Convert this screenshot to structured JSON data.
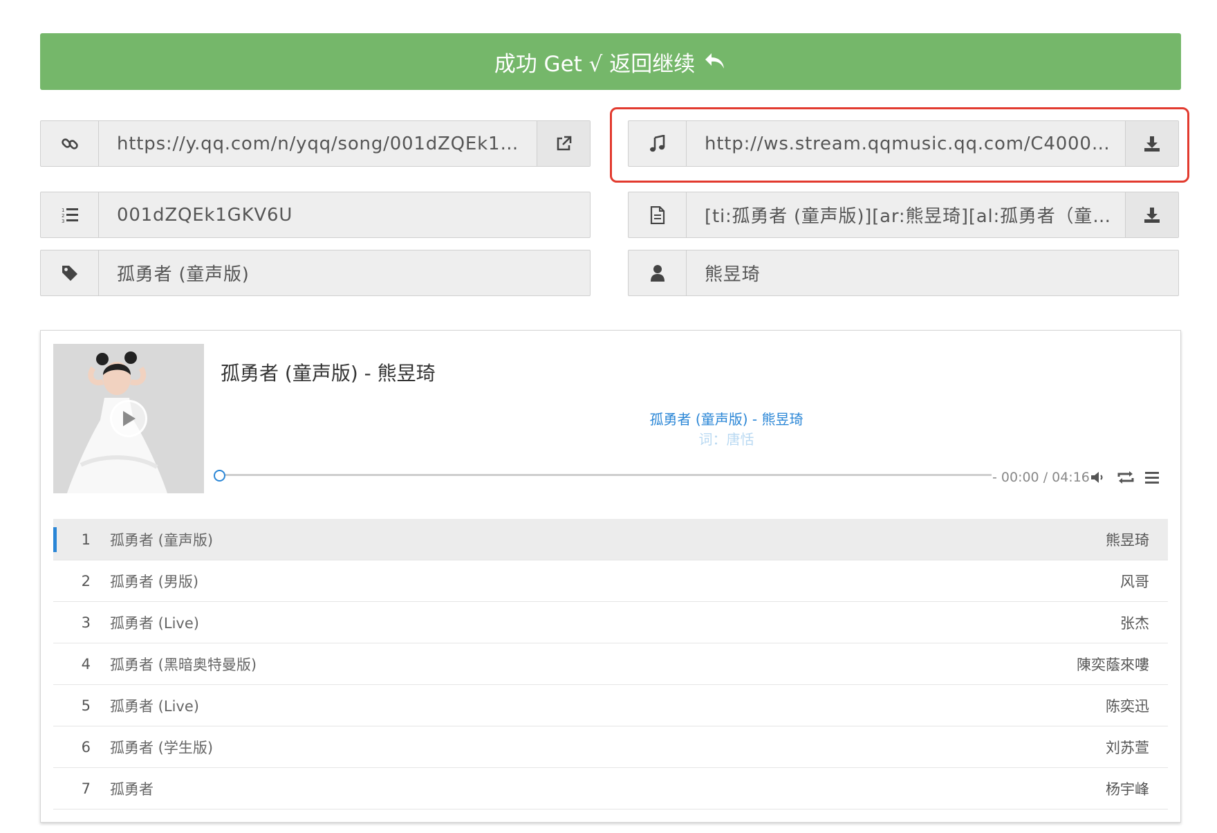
{
  "banner": {
    "text": "成功 Get √ 返回继续"
  },
  "fields": {
    "song_url": "https://y.qq.com/n/yqq/song/001dZQEk1G...",
    "stream_url": "http://ws.stream.qqmusic.qq.com/C400001...",
    "song_mid": "001dZQEk1GKV6U",
    "lyrics": "[ti:孤勇者 (童声版)][ar:熊昱琦][al:孤勇者（童声...",
    "song_name": "孤勇者 (童声版)",
    "artist": "熊昱琦"
  },
  "player": {
    "title": "孤勇者 (童声版) - 熊昱琦",
    "lyric_current": "孤勇者 (童声版) - 熊昱琦",
    "lyric_next": "词：唐恬",
    "time": "- 00:00 / 04:16",
    "progress": 0
  },
  "playlist": [
    {
      "index": "1",
      "title": "孤勇者 (童声版)",
      "artist": "熊昱琦",
      "active": true
    },
    {
      "index": "2",
      "title": "孤勇者 (男版)",
      "artist": "风哥"
    },
    {
      "index": "3",
      "title": "孤勇者 (Live)",
      "artist": "张杰"
    },
    {
      "index": "4",
      "title": "孤勇者 (黑暗奥特曼版)",
      "artist": "陳奕蔭來嘍"
    },
    {
      "index": "5",
      "title": "孤勇者 (Live)",
      "artist": "陈奕迅"
    },
    {
      "index": "6",
      "title": "孤勇者 (学生版)",
      "artist": "刘苏萱"
    },
    {
      "index": "7",
      "title": "孤勇者",
      "artist": "杨宇峰"
    }
  ],
  "colors": {
    "banner": "#75b76a",
    "accent": "#2a86d6",
    "highlight": "#e23a2e"
  },
  "icons": [
    "return-arrow-icon",
    "link-icon",
    "external-link-icon",
    "music-note-icon",
    "download-icon",
    "ordered-list-icon",
    "document-icon",
    "tag-icon",
    "user-icon",
    "play-icon",
    "volume-icon",
    "loop-icon",
    "menu-icon"
  ]
}
